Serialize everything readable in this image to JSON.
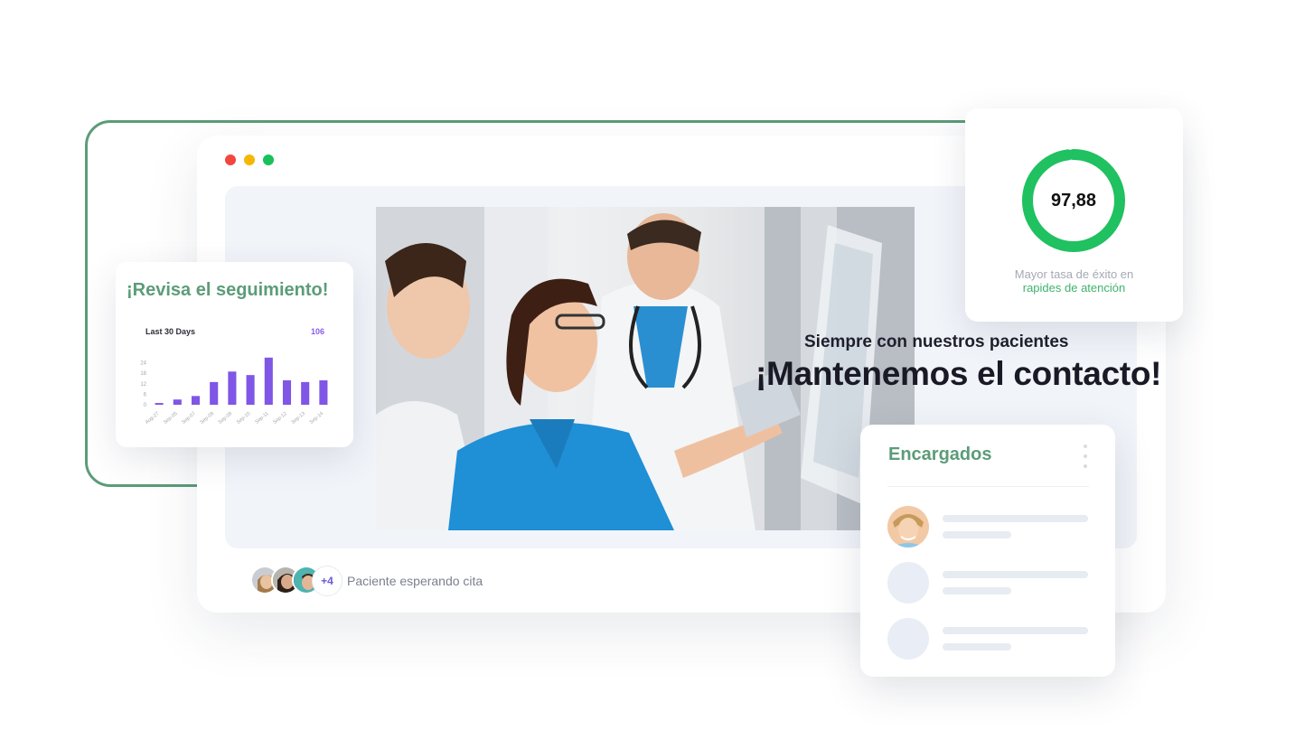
{
  "window": {
    "dots": [
      "#f2473f",
      "#f5b700",
      "#19c15a"
    ]
  },
  "followup": {
    "title": "¡Revisa el seguimiento!",
    "chart_label": "Last 30 Days",
    "chart_total": "106"
  },
  "chart_data": {
    "type": "bar",
    "categories": [
      "Aug-27",
      "Sep-05",
      "Sep-07",
      "Sep-08",
      "Sep-09",
      "Sep-10",
      "Sep-11",
      "Sep-12",
      "Sep-13",
      "Sep-14"
    ],
    "values": [
      1,
      3,
      5,
      13,
      19,
      17,
      27,
      14,
      13,
      14
    ],
    "yticks": [
      0,
      6,
      12,
      18,
      24
    ],
    "ylim": [
      0,
      30
    ],
    "title": "Last 30 Days",
    "color": "#7f56e6",
    "grid": false
  },
  "success": {
    "value": "97,88",
    "line1": "Mayor tasa de éxito en",
    "line2": "rapides de atención",
    "ring_fraction": 0.9788,
    "ring_color": "#1fc160",
    "track_color": "#e8ecef"
  },
  "tagline": {
    "small": "Siempre con nuestros pacientes",
    "big": "¡Mantenemos el contacto!"
  },
  "team": {
    "title": "Encargados",
    "members": [
      "member-photo",
      "placeholder",
      "placeholder"
    ]
  },
  "waiting": {
    "more": "+4",
    "label": "Paciente esperando cita"
  }
}
